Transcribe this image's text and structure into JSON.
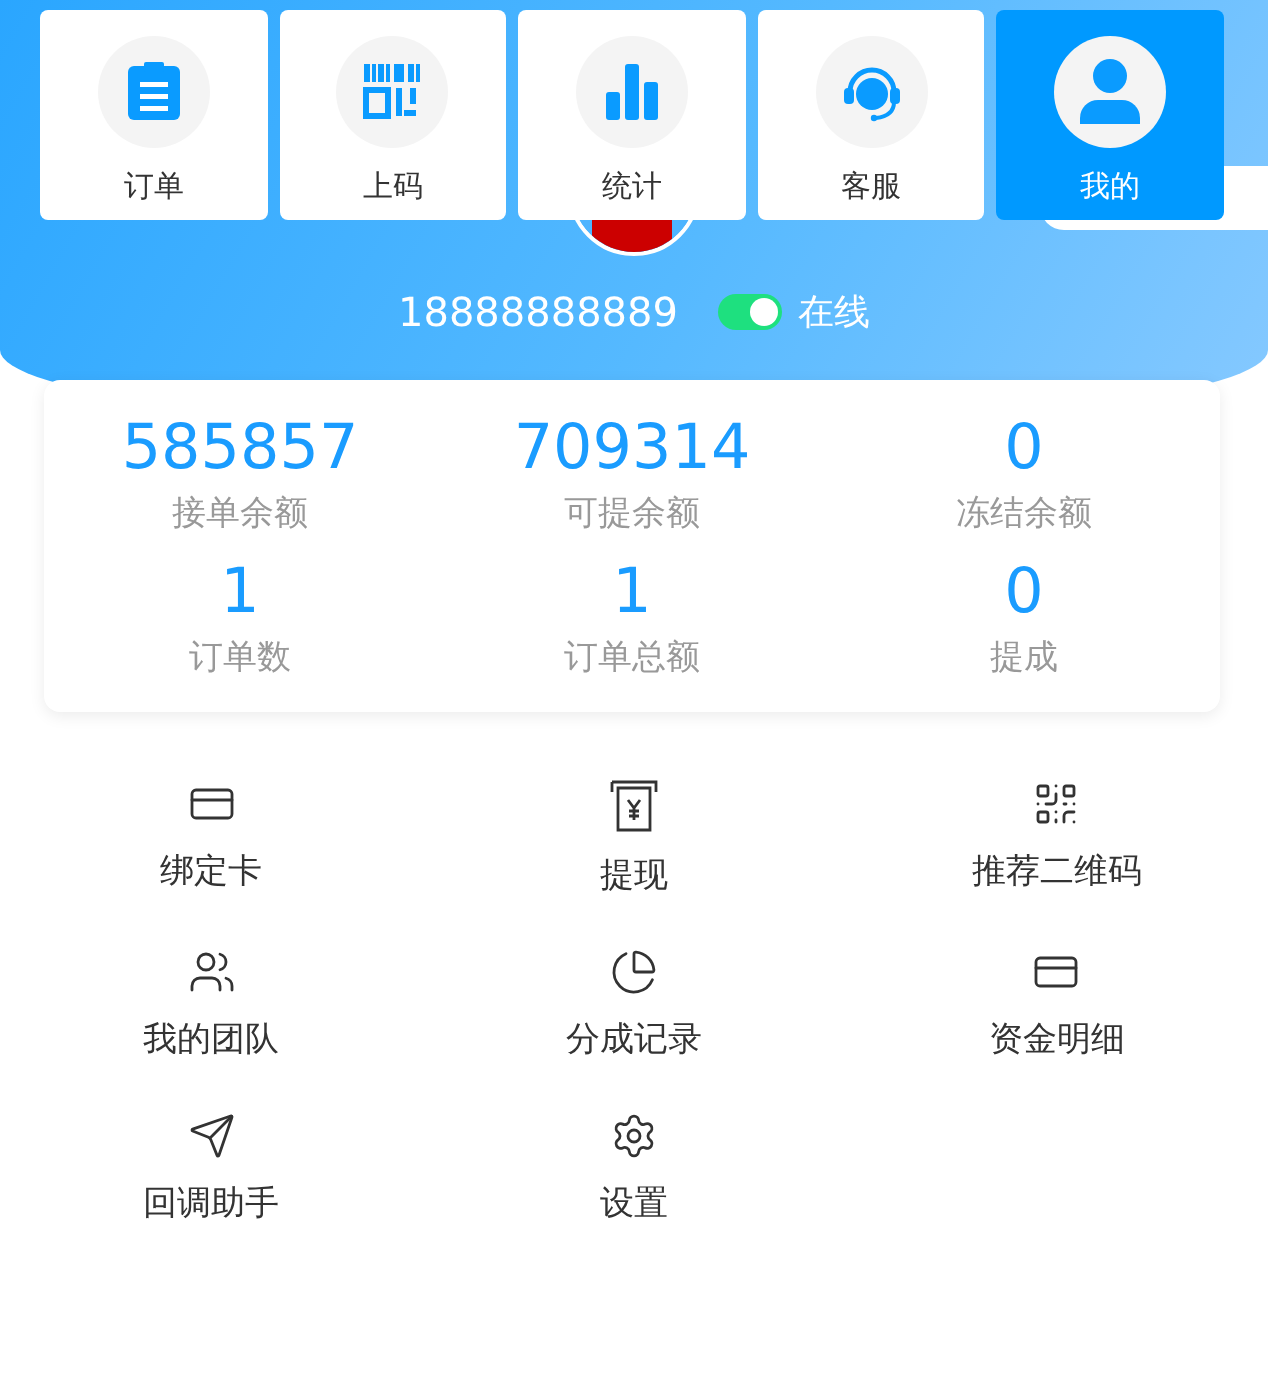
{
  "nav_tabs": [
    {
      "label": "订单",
      "kind": "orders",
      "selected": false
    },
    {
      "label": "上码",
      "kind": "code",
      "selected": false
    },
    {
      "label": "统计",
      "kind": "stats",
      "selected": false
    },
    {
      "label": "客服",
      "kind": "support",
      "selected": false
    },
    {
      "label": "我的",
      "kind": "profile",
      "selected": true
    }
  ],
  "profile": {
    "phone": "18888888889",
    "status": {
      "label": "在线",
      "on": true
    }
  },
  "stats": [
    {
      "value": "585857",
      "label": "接单余额"
    },
    {
      "value": "709314",
      "label": "可提余额"
    },
    {
      "value": "0",
      "label": "冻结余额"
    },
    {
      "value": "1",
      "label": "订单数"
    },
    {
      "value": "1",
      "label": "订单总额"
    },
    {
      "value": "0",
      "label": "提成"
    }
  ],
  "menu": [
    {
      "label": "绑定卡",
      "kind": "card"
    },
    {
      "label": "提现",
      "kind": "withdraw"
    },
    {
      "label": "推荐二维码",
      "kind": "qr"
    },
    {
      "label": "我的团队",
      "kind": "team"
    },
    {
      "label": "分成记录",
      "kind": "pie"
    },
    {
      "label": "资金明细",
      "kind": "card"
    },
    {
      "label": "回调助手",
      "kind": "send"
    },
    {
      "label": "设置",
      "kind": "settings"
    }
  ]
}
